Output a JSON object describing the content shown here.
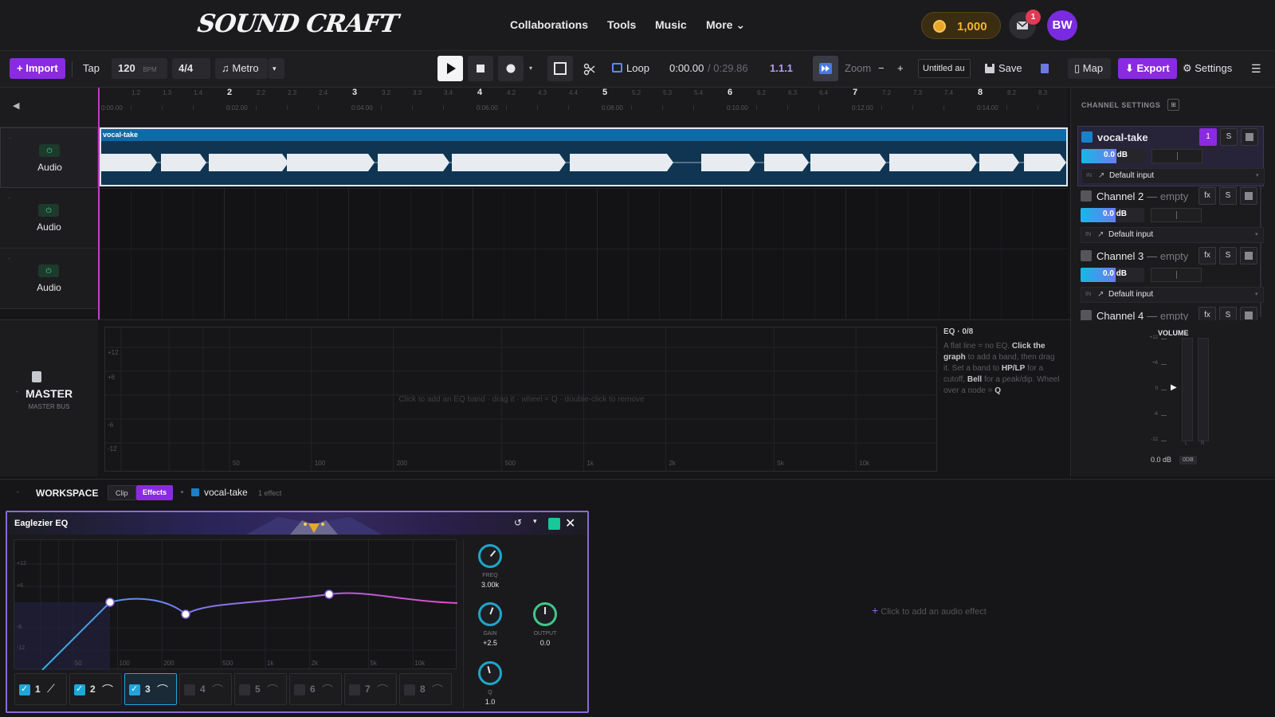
{
  "nav": {
    "logo": "SOUND CRAFT",
    "links": [
      "Collaborations",
      "Tools",
      "Music",
      "More ⌄"
    ],
    "coins": "1,000",
    "notifications": "1",
    "avatar": "BW"
  },
  "toolbar": {
    "import": "+ Import",
    "tap": "Tap",
    "bpm": "120",
    "bpm_unit": "BPM",
    "time_sig": "4/4 ⌄",
    "metro": "♫ Metro",
    "metro_caret": "▾",
    "loop": "Loop",
    "time_current": "0:00.00",
    "time_total": "/ 0:29.86",
    "position": "1.1.1",
    "zoom": "Zoom",
    "zoom_minus": "−",
    "zoom_plus": "+",
    "project_name": "Untitled au",
    "save": "Save",
    "map": "▯ Map",
    "export": "⬇ Export",
    "settings": "⚙ Settings",
    "menu": "☰"
  },
  "ruler": {
    "bars": [
      {
        "n": "",
        "t": "0:00.00",
        "subs": [
          "1.2",
          "1.3",
          "1.4"
        ]
      },
      {
        "n": "2",
        "t": "0:02.00",
        "subs": [
          "2.2",
          "2.3",
          "2.4"
        ]
      },
      {
        "n": "3",
        "t": "0:04.00",
        "subs": [
          "3.2",
          "3.3",
          "3.4"
        ]
      },
      {
        "n": "4",
        "t": "0:06.00",
        "subs": [
          "4.2",
          "4.3",
          "4.4"
        ]
      },
      {
        "n": "5",
        "t": "0:08.00",
        "subs": [
          "5.2",
          "5.3",
          "5.4"
        ]
      },
      {
        "n": "6",
        "t": "0:10.00",
        "subs": [
          "6.2",
          "6.3",
          "6.4"
        ]
      },
      {
        "n": "7",
        "t": "0:12.00",
        "subs": [
          "7.2",
          "7.3",
          "7.4"
        ]
      },
      {
        "n": "8",
        "t": "0:14.00",
        "subs": [
          "8.2",
          "8.3"
        ]
      }
    ]
  },
  "tracks": [
    {
      "label": "Audio",
      "power": "⏻"
    },
    {
      "label": "Audio",
      "power": "⏻"
    },
    {
      "label": "Audio",
      "power": "⏻"
    }
  ],
  "clip": {
    "name": "vocal-take"
  },
  "channel_settings": {
    "title": "CHANNEL SETTINGS",
    "channels": [
      {
        "name": "vocal-take",
        "suffix": "",
        "btn1": "1",
        "db": "0.0 dB",
        "input": "Default input",
        "in_label": "IN"
      },
      {
        "name": "Channel 2",
        "suffix": "— empty",
        "btn1": "fx",
        "db": "0.0 dB",
        "input": "Default input",
        "in_label": "IN"
      },
      {
        "name": "Channel 3",
        "suffix": "— empty",
        "btn1": "fx",
        "db": "0.0 dB",
        "input": "Default input",
        "in_label": "IN"
      },
      {
        "name": "Channel 4",
        "suffix": "— empty",
        "btn1": "fx",
        "db": "",
        "input": "",
        "in_label": ""
      }
    ],
    "solo": "S"
  },
  "master": {
    "title": "MASTER",
    "subtitle": "MASTER BUS"
  },
  "eq": {
    "hint": "Click to add an EQ band · drag it · wheel = Q · double-click to remove",
    "y_labels": [
      "+12",
      "+6",
      "-6",
      "-12"
    ],
    "x_labels": [
      "50",
      "100",
      "200",
      "500",
      "1k",
      "2k",
      "5k",
      "10k"
    ],
    "info_title": "EQ · 0/8",
    "info_text_1": "A flat line = no EQ.",
    "info_bold_1": "Click the graph",
    "info_text_2": "to add a band, then drag it. Set a band to",
    "info_bold_2": "HP/LP",
    "info_text_3": "for a cutoff,",
    "info_bold_3": "Bell",
    "info_text_4": "for a peak/dip. Wheel over a node =",
    "info_bold_4": "Q"
  },
  "volume": {
    "title": "VOLUME",
    "scale": [
      "+12",
      "+6",
      "0",
      "-6",
      "-12"
    ],
    "lr": [
      "L",
      "R"
    ],
    "value": "0.0 dB",
    "reset": "0DB"
  },
  "workspace": {
    "title": "WORKSPACE",
    "tab_clip": "Clip",
    "tab_effects": "Effects",
    "track": "vocal-take",
    "effects_count": "1 effect",
    "add_effect": "Click to add an audio effect"
  },
  "plugin": {
    "title": "Eaglezier EQ",
    "y_labels": [
      "+12",
      "+6",
      "-6",
      "-12"
    ],
    "x_labels": [
      "50",
      "100",
      "200",
      "500",
      "1k",
      "2k",
      "5k",
      "10k"
    ],
    "knobs": [
      {
        "label": "FREQ",
        "value": "3.00k"
      },
      {
        "label": "GAIN",
        "value": "+2.5"
      },
      {
        "label": "OUTPUT",
        "value": "0.0"
      },
      {
        "label": "Q",
        "value": "1.0"
      }
    ],
    "bands": [
      "1",
      "2",
      "3",
      "4",
      "5",
      "6",
      "7",
      "8"
    ],
    "bands_on": [
      true,
      true,
      true,
      false,
      false,
      false,
      false,
      false
    ],
    "selected_band": 3
  },
  "colors": {
    "accent": "#8a2be2",
    "clip_header": "#0f6aa8",
    "eq_line_start": "#2ab6e8",
    "eq_line_end": "#e04ac8"
  }
}
